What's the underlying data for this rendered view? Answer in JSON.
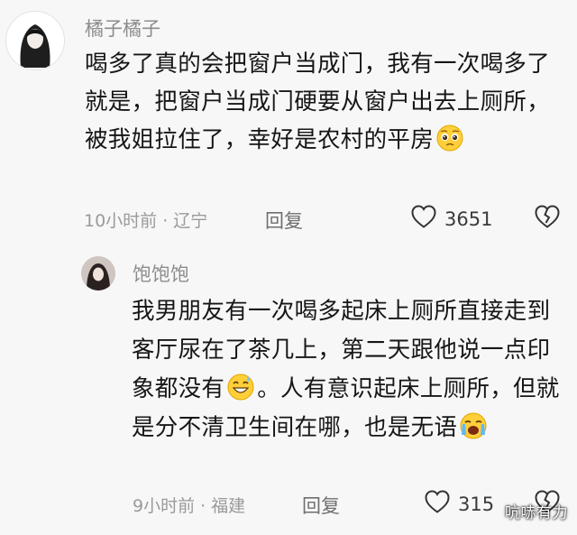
{
  "comments": [
    {
      "username": "橘子橘子",
      "text_before_emoji": "喝多了真的会把窗户当成门，我有一次喝多了就是，把窗户当成门硬要从窗户出去上厕所，被我姐拉住了，幸好是农村的平房",
      "emoji": "pleading-face",
      "text_after_emoji": "",
      "time": "10小时前",
      "location": "辽宁",
      "reply_label": "回复",
      "likes": "3651"
    },
    {
      "username": "饱饱饱",
      "text_before_emoji": "我男朋友有一次喝多起床上厕所直接走到客厅尿在了茶几上，第二天跟他说一点印象都没有",
      "emoji": "grinning-sweat-face",
      "text_middle": "。人有意识起床上厕所，但就是分不清卫生间在哪，也是无语",
      "emoji2": "crying-face",
      "time": "9小时前",
      "location": "福建",
      "reply_label": "回复",
      "likes": "315"
    }
  ],
  "watermark": "吭哧有力"
}
